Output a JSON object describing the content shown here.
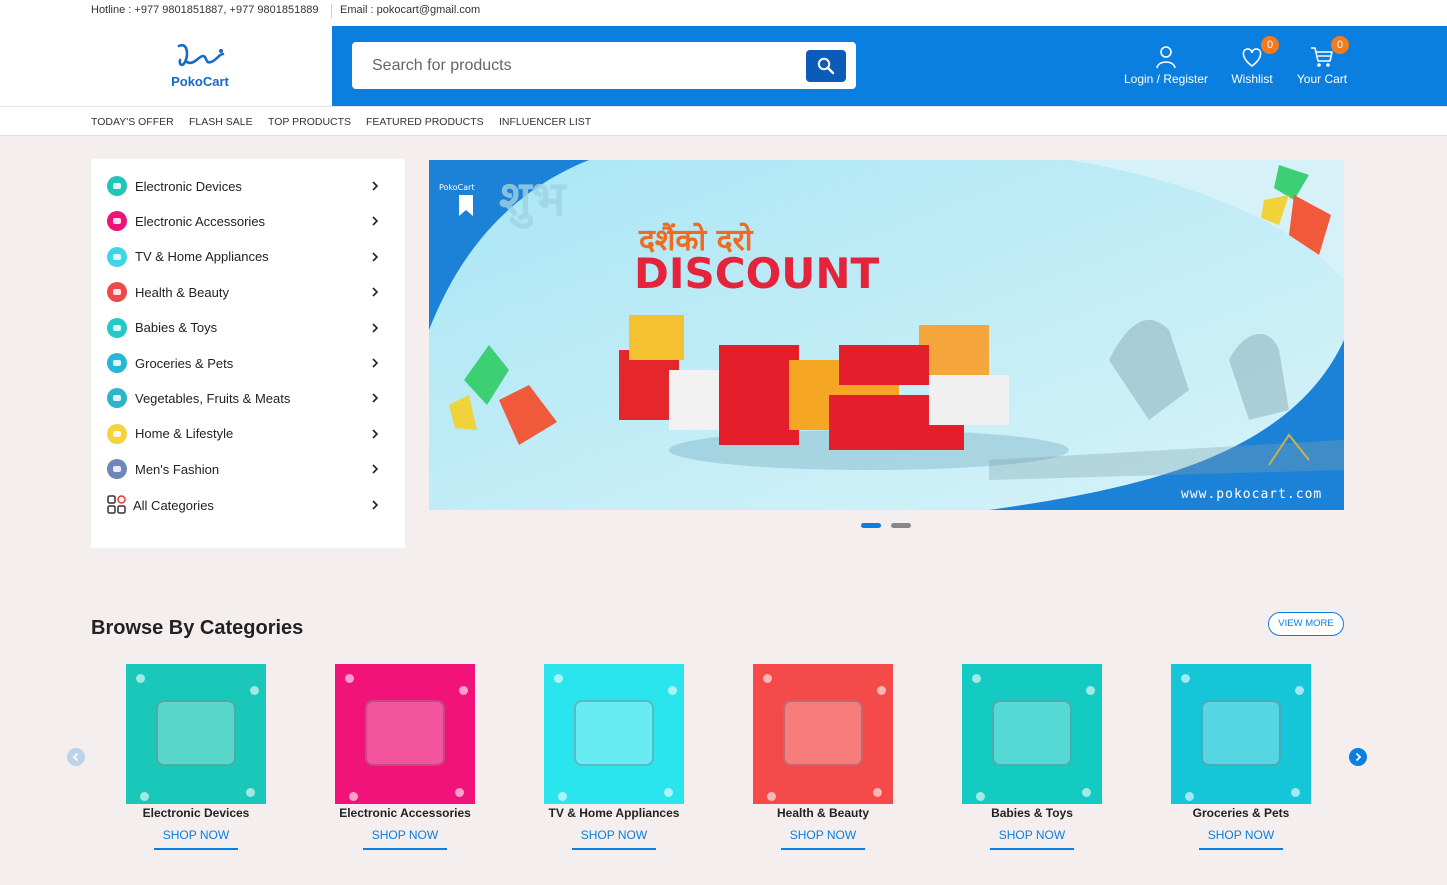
{
  "topbar": {
    "hotline": "Hotline : +977 9801851887, +977 9801851889",
    "email": "Email : pokocart@gmail.com"
  },
  "header": {
    "logo_text": "PokoCart",
    "search_placeholder": "Search for products",
    "login_label": "Login / Register",
    "wishlist_label": "Wishlist",
    "wishlist_count": "0",
    "cart_label": "Your Cart",
    "cart_count": "0"
  },
  "nav": {
    "items": [
      "TODAY'S OFFER",
      "FLASH SALE",
      "TOP PRODUCTS",
      "FEATURED PRODUCTS",
      "INFLUENCER LIST"
    ]
  },
  "categories": {
    "items": [
      {
        "label": "Electronic Devices",
        "color": "#1fc6b6"
      },
      {
        "label": "Electronic Accessories",
        "color": "#ee1477"
      },
      {
        "label": "TV & Home Appliances",
        "color": "#3dd6e8"
      },
      {
        "label": "Health & Beauty",
        "color": "#f04848"
      },
      {
        "label": "Babies & Toys",
        "color": "#23c9c4"
      },
      {
        "label": "Groceries & Pets",
        "color": "#23b8d8"
      },
      {
        "label": "Vegetables, Fruits & Meats",
        "color": "#2fb3c8"
      },
      {
        "label": "Home & Lifestyle",
        "color": "#f4d23a"
      },
      {
        "label": "Men's Fashion",
        "color": "#6f86b8"
      }
    ],
    "all_label": "All Categories"
  },
  "banner": {
    "headline_np": "दशैंको दरो",
    "headline": "DISCOUNT",
    "watermark": "शुभ",
    "logo_text": "PokoCart",
    "url": "www.pokocart.com"
  },
  "browse": {
    "title": "Browse By Categories",
    "view_more": "VIEW MORE",
    "cards": [
      {
        "name": "Electronic Devices",
        "cta": "SHOP NOW",
        "color": "#19c8b8"
      },
      {
        "name": "Electronic Accessories",
        "cta": "SHOP NOW",
        "color": "#f2137a"
      },
      {
        "name": "TV & Home Appliances",
        "cta": "SHOP NOW",
        "color": "#2be5ee"
      },
      {
        "name": "Health & Beauty",
        "cta": "SHOP NOW",
        "color": "#f44a4a"
      },
      {
        "name": "Babies & Toys",
        "cta": "SHOP NOW",
        "color": "#14cbc4"
      },
      {
        "name": "Groceries & Pets",
        "cta": "SHOP NOW",
        "color": "#15c6d9"
      }
    ]
  }
}
